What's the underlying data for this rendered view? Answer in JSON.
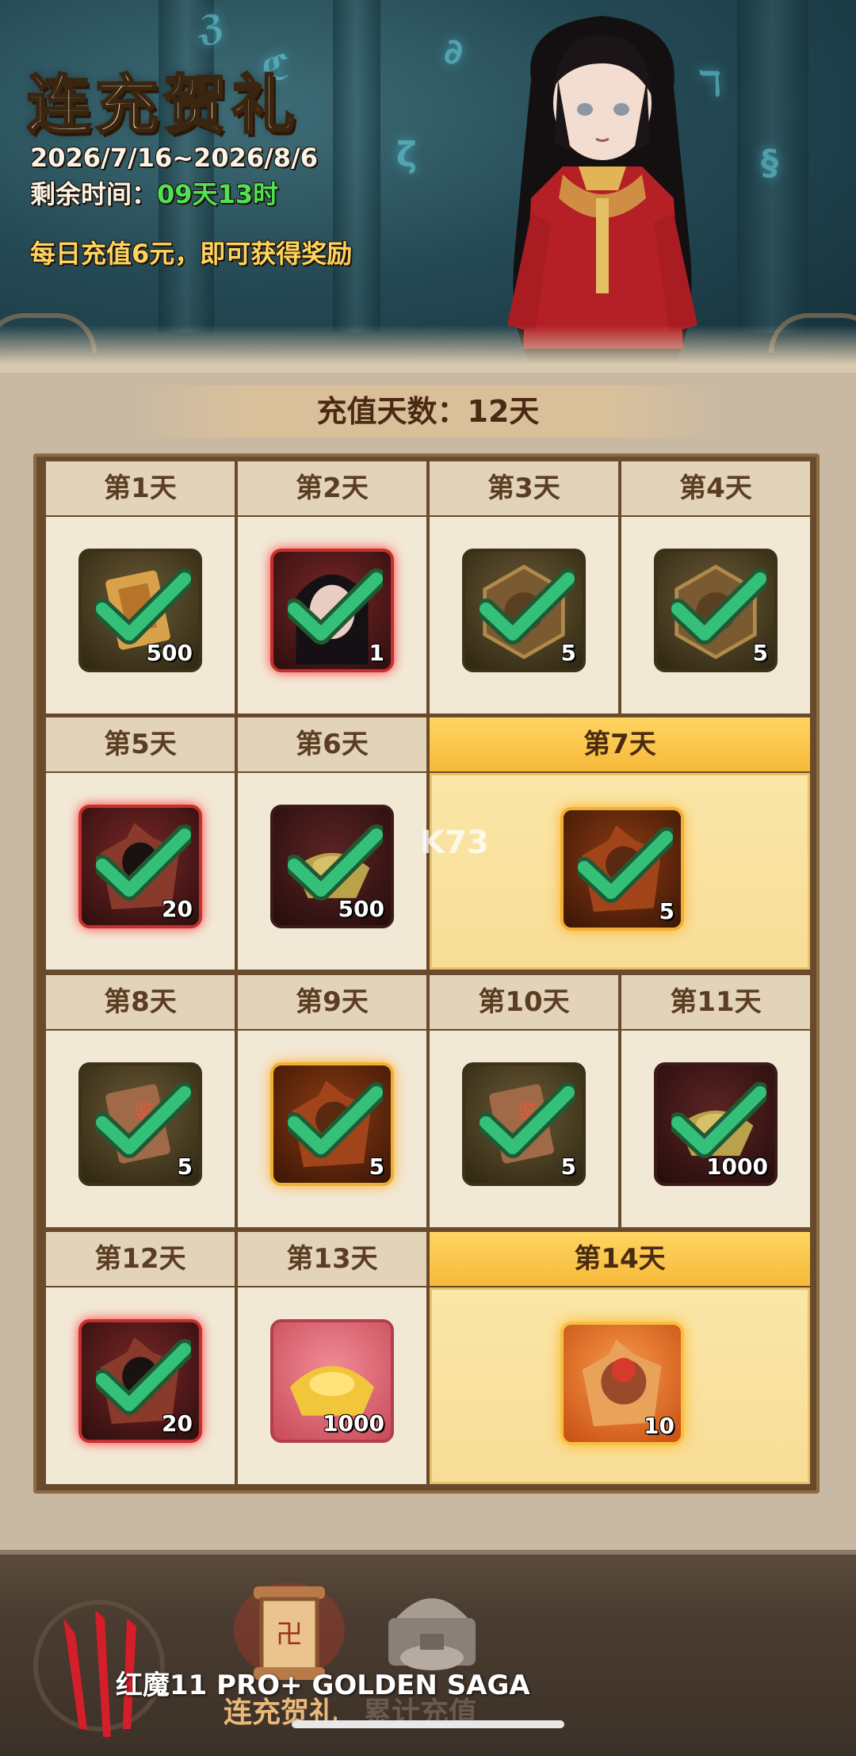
{
  "event": {
    "title": "连充贺礼",
    "date_range": "2026/7/16~2026/8/6",
    "remaining_label": "剩余时间：",
    "remaining_value": "09天13时",
    "rule": "每日充值6元，即可获得奖励"
  },
  "progress": {
    "label": "充值天数：12天",
    "days_recharged": 12
  },
  "rewards": [
    {
      "day": "第1天",
      "count": "500",
      "claimed": true,
      "icon": "scroll-ticket-icon",
      "quality": "brown"
    },
    {
      "day": "第2天",
      "count": "1",
      "claimed": true,
      "icon": "hero-portrait-icon",
      "quality": "red"
    },
    {
      "day": "第3天",
      "count": "5",
      "claimed": true,
      "icon": "bronze-compass-icon",
      "quality": "brown"
    },
    {
      "day": "第4天",
      "count": "5",
      "claimed": true,
      "icon": "bronze-compass-icon",
      "quality": "brown"
    },
    {
      "day": "第5天",
      "count": "20",
      "claimed": true,
      "icon": "hero-fragment-icon",
      "quality": "red"
    },
    {
      "day": "第6天",
      "count": "500",
      "claimed": true,
      "icon": "ingot-icon",
      "quality": "dark"
    },
    {
      "day": "第7天",
      "count": "5",
      "claimed": true,
      "icon": "gold-fragment-icon",
      "quality": "gold"
    },
    {
      "day": "第8天",
      "count": "5",
      "claimed": true,
      "icon": "appraise-ticket-icon",
      "quality": "brown"
    },
    {
      "day": "第9天",
      "count": "5",
      "claimed": true,
      "icon": "gold-fragment-icon",
      "quality": "gold"
    },
    {
      "day": "第10天",
      "count": "5",
      "claimed": true,
      "icon": "appraise-ticket-icon",
      "quality": "brown"
    },
    {
      "day": "第11天",
      "count": "1000",
      "claimed": true,
      "icon": "ingot-icon",
      "quality": "dark"
    },
    {
      "day": "第12天",
      "count": "20",
      "claimed": true,
      "icon": "hero-fragment-icon",
      "quality": "red"
    },
    {
      "day": "第13天",
      "count": "1000",
      "claimed": false,
      "icon": "gold-ingot-icon",
      "quality": "pink"
    },
    {
      "day": "第14天",
      "count": "10",
      "claimed": false,
      "icon": "monkey-king-fragment-icon",
      "quality": "orange"
    }
  ],
  "watermark": "K73",
  "nav": {
    "tab_continuous": "连充贺礼",
    "tab_cumulative": "累计充值"
  },
  "device_watermark": "红魔11 PRO+ GOLDEN SAGA",
  "colors": {
    "accent_green": "#4fe254",
    "gold_header": "#f6b93a",
    "text_brown": "#5a3d22"
  }
}
